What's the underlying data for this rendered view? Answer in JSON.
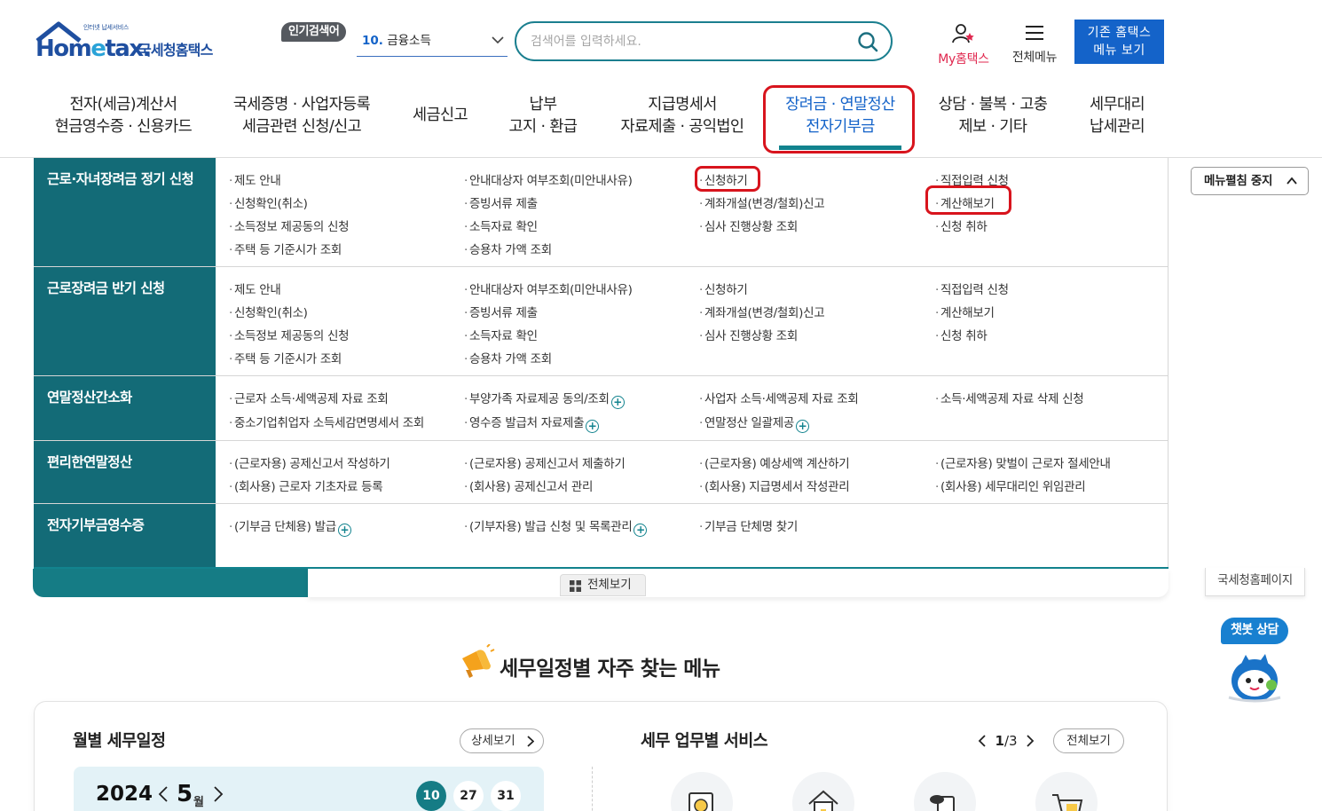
{
  "header": {
    "logo_tagline": "인터넷 납세서비스",
    "logo_brand": "Hometax",
    "logo_kr": "국세청홈택스",
    "popular_badge": "인기검색어",
    "popular_rank": "10.",
    "popular_keyword": "금융소득",
    "search_placeholder": "검색어를 입력하세요.",
    "my_home_label": "My홈택스",
    "all_menu_label": "전체메뉴",
    "old_hometax_line1": "기존 홈택스",
    "old_hometax_line2": "메뉴 보기"
  },
  "gnb": [
    {
      "line1": "전자(세금)계산서",
      "line2": "현금영수증 · 신용카드"
    },
    {
      "line1": "국세증명 · 사업자등록",
      "line2": "세금관련 신청/신고"
    },
    {
      "line1": "세금신고",
      "line2": ""
    },
    {
      "line1": "납부",
      "line2": "고지 · 환급"
    },
    {
      "line1": "지급명세서",
      "line2": "자료제출 · 공익법인"
    },
    {
      "line1": "장려금 · 연말정산",
      "line2": "전자기부금",
      "active": true
    },
    {
      "line1": "상담 · 불복 · 고충",
      "line2": "제보 · 기타"
    },
    {
      "line1": "세무대리",
      "line2": "납세관리"
    }
  ],
  "mega_menu": {
    "sections": [
      {
        "title": "근로·자녀장려금 정기 신청",
        "columns": [
          [
            "제도 안내",
            "신청확인(취소)",
            "소득정보 제공동의 신청",
            "주택 등 기준시가 조회"
          ],
          [
            "안내대상자 여부조회(미안내사유)",
            "증빙서류 제출",
            "소득자료 확인",
            "승용차 가액 조회"
          ],
          [
            "신청하기",
            "계좌개설(변경/철회)신고",
            "심사 진행상황 조회"
          ],
          [
            "직접입력 신청",
            "계산해보기",
            "신청 취하"
          ]
        ]
      },
      {
        "title": "근로장려금 반기 신청",
        "columns": [
          [
            "제도 안내",
            "신청확인(취소)",
            "소득정보 제공동의 신청",
            "주택 등 기준시가 조회"
          ],
          [
            "안내대상자 여부조회(미안내사유)",
            "증빙서류 제출",
            "소득자료 확인",
            "승용차 가액 조회"
          ],
          [
            "신청하기",
            "계좌개설(변경/철회)신고",
            "심사 진행상황 조회"
          ],
          [
            "직접입력 신청",
            "계산해보기",
            "신청 취하"
          ]
        ]
      },
      {
        "title": "연말정산간소화",
        "columns": [
          [
            "근로자 소득·세액공제 자료 조회",
            "중소기업취업자 소득세감면명세서 조회"
          ],
          [
            "부양가족 자료제공 동의/조회",
            "영수증 발급처 자료제출"
          ],
          [
            "사업자 소득·세액공제 자료 조회",
            "연말정산 일괄제공"
          ],
          [
            "소득·세액공제 자료 삭제 신청"
          ]
        ]
      },
      {
        "title": "편리한연말정산",
        "columns": [
          [
            "(근로자용) 공제신고서 작성하기",
            "(회사용) 근로자 기초자료 등록"
          ],
          [
            "(근로자용) 공제신고서 제출하기",
            "(회사용) 공제신고서 관리"
          ],
          [
            "(근로자용) 예상세액 계산하기",
            "(회사용) 지급명세서 작성관리"
          ],
          [
            "(근로자용) 맞벌이 근로자 절세안내",
            "(회사용) 세무대리인 위임관리"
          ]
        ]
      },
      {
        "title": "전자기부금영수증",
        "columns": [
          [
            "(기부금 단체용) 발급"
          ],
          [
            "(기부자용) 발급 신청 및 목록관리"
          ],
          [
            "기부금 단체명 찾기"
          ],
          []
        ]
      }
    ],
    "stop_unfold_label": "메뉴펼침 중지",
    "full_view_label": "전체보기"
  },
  "side": {
    "nts_homepage": "국세청홈페이지",
    "chatbot_label": "챗봇 상담"
  },
  "section": {
    "title": "세무일정별 자주 찾는 메뉴",
    "monthly_title": "월별 세무일정",
    "monthly_more": "상세보기",
    "year": "2024",
    "month": "5",
    "month_unit": "월",
    "days": [
      "10",
      "27",
      "31"
    ],
    "services_title": "세무 업무별 서비스",
    "page_current": "1",
    "page_total": "3",
    "services_all": "전체보기"
  },
  "colors": {
    "teal": "#136b77",
    "blue": "#1463c9",
    "highlight_red": "#d8141d",
    "my_home_red": "#e0284f"
  }
}
